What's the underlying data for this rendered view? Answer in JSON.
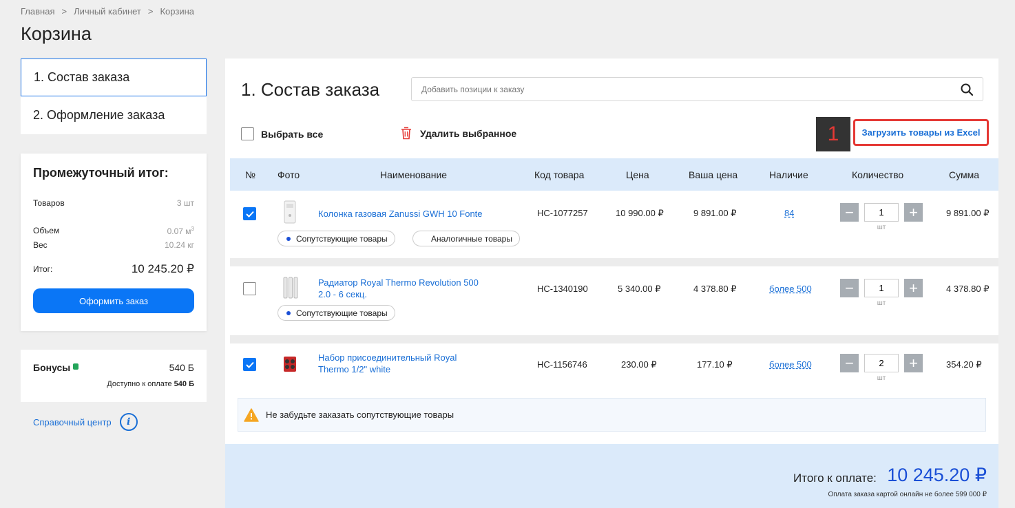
{
  "breadcrumb": [
    "Главная",
    ">",
    "Личный кабинет",
    ">",
    "Корзина"
  ],
  "page_title": "Корзина",
  "steps": [
    {
      "label": "1. Состав заказа",
      "active": true
    },
    {
      "label": "2. Оформление заказа",
      "active": false
    }
  ],
  "summary": {
    "title": "Промежуточный итог:",
    "items_label": "Товаров",
    "items_value": "3 шт",
    "volume_label": "Объем",
    "volume_value": "0.07 м",
    "volume_sup": "3",
    "weight_label": "Вес",
    "weight_value": "10.24 кг",
    "total_label": "Итог:",
    "total_value": "10 245.20 ₽",
    "checkout_button": "Оформить заказ"
  },
  "bonus": {
    "label": "Бонусы",
    "value": "540 Б",
    "available_text": "Доступно к оплате",
    "available_value": "540 Б"
  },
  "help_link": "Справочный центр",
  "main": {
    "title": "1. Состав заказа",
    "search_placeholder": "Добавить позиции к заказу",
    "select_all": "Выбрать все",
    "delete_selected": "Удалить выбранное",
    "step_marker": "1",
    "excel_link": "Загрузить товары из Excel"
  },
  "columns": [
    "№",
    "Фото",
    "Наименование",
    "Код товара",
    "Цена",
    "Ваша цена",
    "Наличие",
    "Количество",
    "Сумма"
  ],
  "rows": [
    {
      "checked": true,
      "name": "Колонка газовая Zanussi GWH 10 Fonte",
      "code": "НС-1077257",
      "price": "10 990.00 ₽",
      "your_price": "9 891.00 ₽",
      "availability": "84",
      "qty": "1",
      "unit": "шт",
      "sum": "9 891.00 ₽",
      "chips": [
        "Сопутствующие товары",
        "Аналогичные товары"
      ]
    },
    {
      "checked": false,
      "name_line1": "Радиатор Royal Thermo Revolution 500",
      "name_line2": "2.0 - 6 секц.",
      "code": "НС-1340190",
      "price": "5 340.00 ₽",
      "your_price": "4 378.80 ₽",
      "availability": "более 500",
      "qty": "1",
      "unit": "шт",
      "sum": "4 378.80 ₽",
      "chips": [
        "Сопутствующие товары"
      ]
    },
    {
      "checked": true,
      "name_line1": "Набор присоединительный Royal",
      "name_line2": "Thermo 1/2\" white",
      "code": "НС-1156746",
      "price": "230.00 ₽",
      "your_price": "177.10 ₽",
      "availability": "более 500",
      "qty": "2",
      "unit": "шт",
      "sum": "354.20 ₽",
      "chips": []
    }
  ],
  "notice": "Не забудьте заказать сопутствующие товары",
  "footer": {
    "total_label": "Итого к оплате:",
    "total_value": "10 245.20 ₽",
    "note": "Оплата заказа картой онлайн не более 599 000 ₽"
  },
  "colors": {
    "accent": "#0a76f6",
    "link": "#1a6fd6",
    "highlight": "#e53935",
    "header_bg": "#dbeafa"
  }
}
